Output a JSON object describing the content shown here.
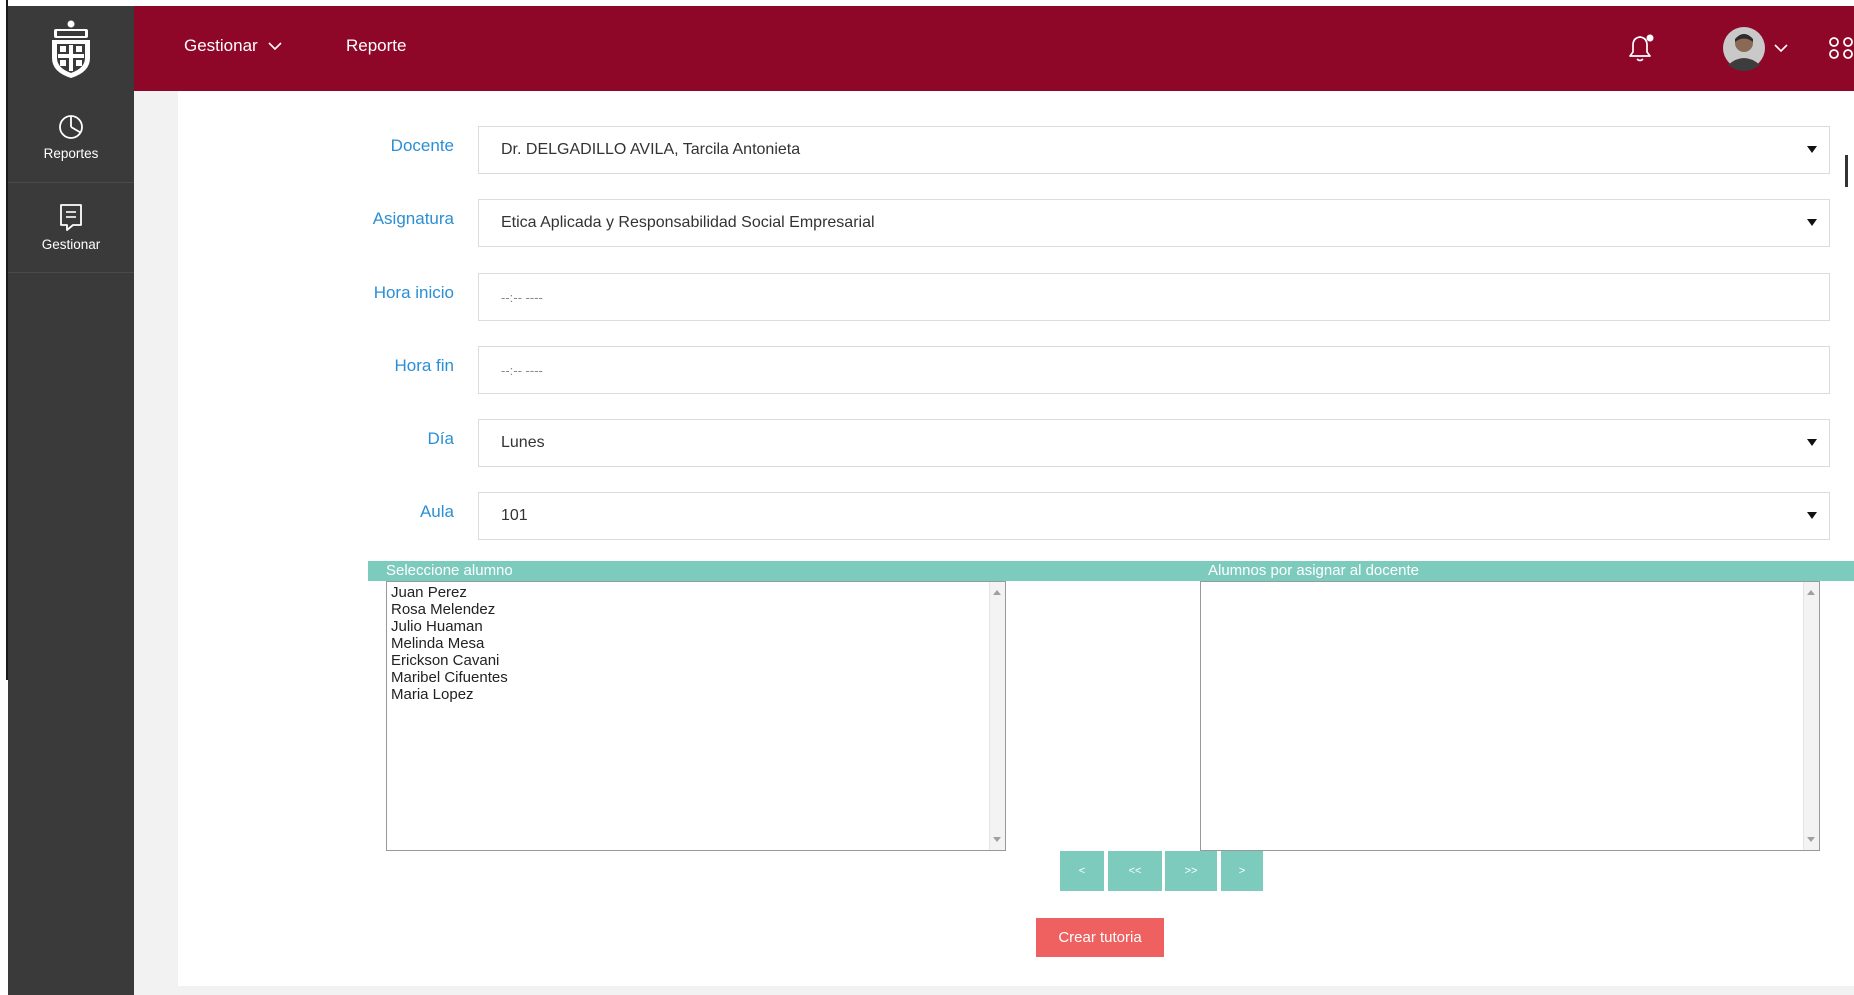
{
  "sidebar": {
    "items": [
      {
        "label": "Reportes",
        "icon": "pie-chart-icon"
      },
      {
        "label": "Gestionar",
        "icon": "clipboard-icon"
      }
    ]
  },
  "topbar": {
    "nav": [
      {
        "label": "Gestionar",
        "has_dropdown": true
      },
      {
        "label": "Reporte",
        "has_dropdown": false
      }
    ],
    "icons": [
      "bell-icon",
      "avatar",
      "apps-grid-icon"
    ]
  },
  "form": {
    "docente": {
      "label": "Docente",
      "value": "Dr. DELGADILLO AVILA, Tarcila Antonieta"
    },
    "asignatura": {
      "label": "Asignatura",
      "value": "Etica Aplicada y Responsabilidad Social Empresarial"
    },
    "hora_inicio": {
      "label": "Hora inicio",
      "value": "--:-- ----"
    },
    "hora_fin": {
      "label": "Hora fin",
      "value": "--:-- ----"
    },
    "dia": {
      "label": "Día",
      "value": "Lunes"
    },
    "aula": {
      "label": "Aula",
      "value": "101"
    }
  },
  "dual_list": {
    "left_title": "Seleccione alumno",
    "right_title": "Alumnos por asignar al docente",
    "left_items": [
      "Juan Perez",
      "Rosa Melendez",
      "Julio Huaman",
      "Melinda Mesa",
      "Erickson Cavani",
      "Maribel Cifuentes",
      "Maria Lopez"
    ],
    "right_items": [],
    "buttons": [
      "<",
      "<<",
      ">>",
      ">"
    ]
  },
  "submit_label": "Crear tutoria",
  "colors": {
    "topbar": "#8e0729",
    "sidebar": "#3a3a3a",
    "label_blue": "#2a8fd6",
    "teal": "#7ccbbd",
    "submit": "#ef6060"
  }
}
